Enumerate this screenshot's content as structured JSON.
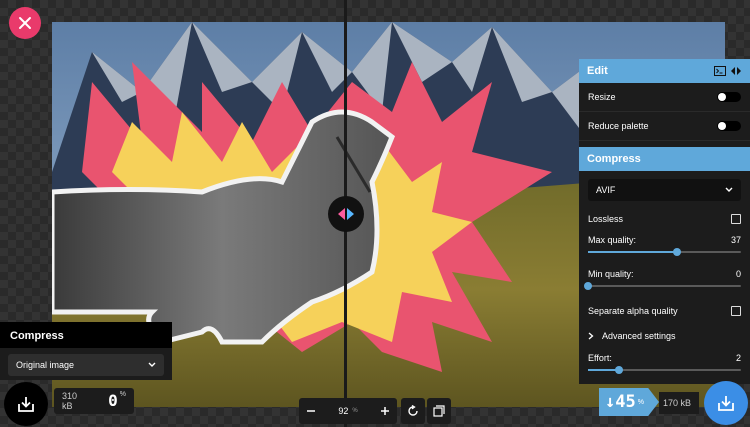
{
  "left_panel": {
    "title": "Compress",
    "method": "Original image"
  },
  "left_stats": {
    "size": "310 kB",
    "percent": "0",
    "percent_unit": "%"
  },
  "zoom": {
    "value": "92",
    "unit": "%"
  },
  "edit": {
    "title": "Edit",
    "resize_label": "Resize",
    "resize_on": false,
    "reduce_palette_label": "Reduce palette",
    "reduce_palette_on": false
  },
  "compress": {
    "title": "Compress",
    "format": "AVIF",
    "lossless_label": "Lossless",
    "lossless_checked": false,
    "max_quality_label": "Max quality:",
    "max_quality_value": "37",
    "max_quality_fraction": 0.58,
    "min_quality_label": "Min quality:",
    "min_quality_value": "0",
    "min_quality_fraction": 0.0,
    "separate_alpha_label": "Separate alpha quality",
    "separate_alpha_checked": false,
    "advanced_label": "Advanced settings",
    "effort_label": "Effort:",
    "effort_value": "2",
    "effort_fraction": 0.2
  },
  "right_stats": {
    "savings": "↓45",
    "savings_unit": "%",
    "size": "170 kB"
  },
  "colors": {
    "accent": "#5fa8da",
    "close": "#e93a6b",
    "download_active": "#3b8ee6"
  }
}
